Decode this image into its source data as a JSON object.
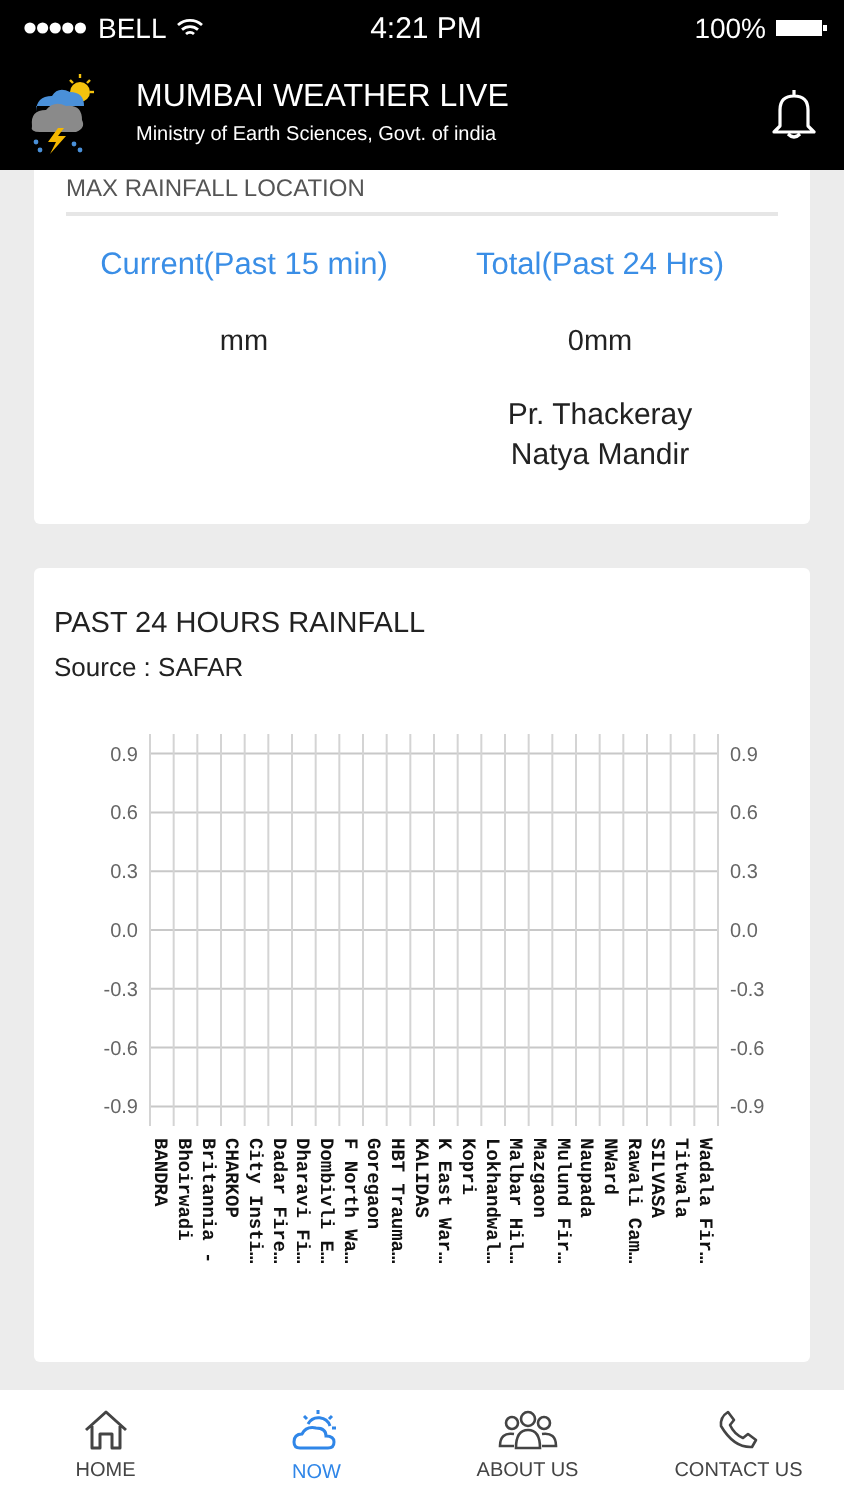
{
  "status_bar": {
    "carrier": "BELL",
    "time": "4:21 PM",
    "battery": "100%"
  },
  "app_bar": {
    "title": "MUMBAI WEATHER LIVE",
    "subtitle": "Ministry of Earth Sciences, Govt. of india"
  },
  "max_rainfall": {
    "heading": "MAX RAINFALL LOCATION",
    "columns": [
      {
        "label": "Current(Past 15 min)",
        "value": "mm"
      },
      {
        "label": "Total(Past 24 Hrs)",
        "value": "0mm",
        "location": "Pr. Thackeray Natya Mandir"
      }
    ]
  },
  "rainfall_card": {
    "title": "PAST 24 HOURS RAINFALL",
    "source": "Source : SAFAR",
    "chart_data": {
      "type": "bar",
      "categories": [
        "BANDRA",
        "Bhoirwadi",
        "Britannia -",
        "CHARKOP",
        "City Insti…",
        "Dadar Fire…",
        "Dharavi Fi…",
        "Dombivli E…",
        "F North Wa…",
        "Goregaon",
        "HBT Trauma…",
        "KALIDAS",
        "K East War…",
        "Kopri",
        "Lokhandwal…",
        "Malbar Hil…",
        "Mazgaon",
        "Mulund Fir…",
        "Naupada",
        "NWard",
        "Rawali Cam…",
        "SILVASA",
        "Titwala",
        "Wadala Fir…"
      ],
      "grid": true,
      "values": [
        null,
        null,
        null,
        null,
        null,
        null,
        null,
        null,
        null,
        null,
        null,
        null,
        null,
        null,
        null,
        null,
        null,
        null,
        null,
        null,
        null,
        null,
        null,
        null
      ],
      "ylim": [
        -1,
        1
      ],
      "yticks": [
        {
          "value": 0.9,
          "label": "0.9"
        },
        {
          "value": 0.6,
          "label": "0.6"
        },
        {
          "value": 0.3,
          "label": "0.3"
        },
        {
          "value": 0,
          "label": "0.0"
        },
        {
          "value": -0.3,
          "label": "-0.3"
        },
        {
          "value": -0.6,
          "label": "-0.6"
        },
        {
          "value": -0.9,
          "label": "-0.9"
        }
      ]
    }
  },
  "tabs": [
    {
      "label": "HOME",
      "kind": "home",
      "selected": false
    },
    {
      "label": "NOW",
      "kind": "weather",
      "selected": true
    },
    {
      "label": "ABOUT US",
      "kind": "people",
      "selected": false
    },
    {
      "label": "CONTACT US",
      "kind": "phone",
      "selected": false
    }
  ]
}
